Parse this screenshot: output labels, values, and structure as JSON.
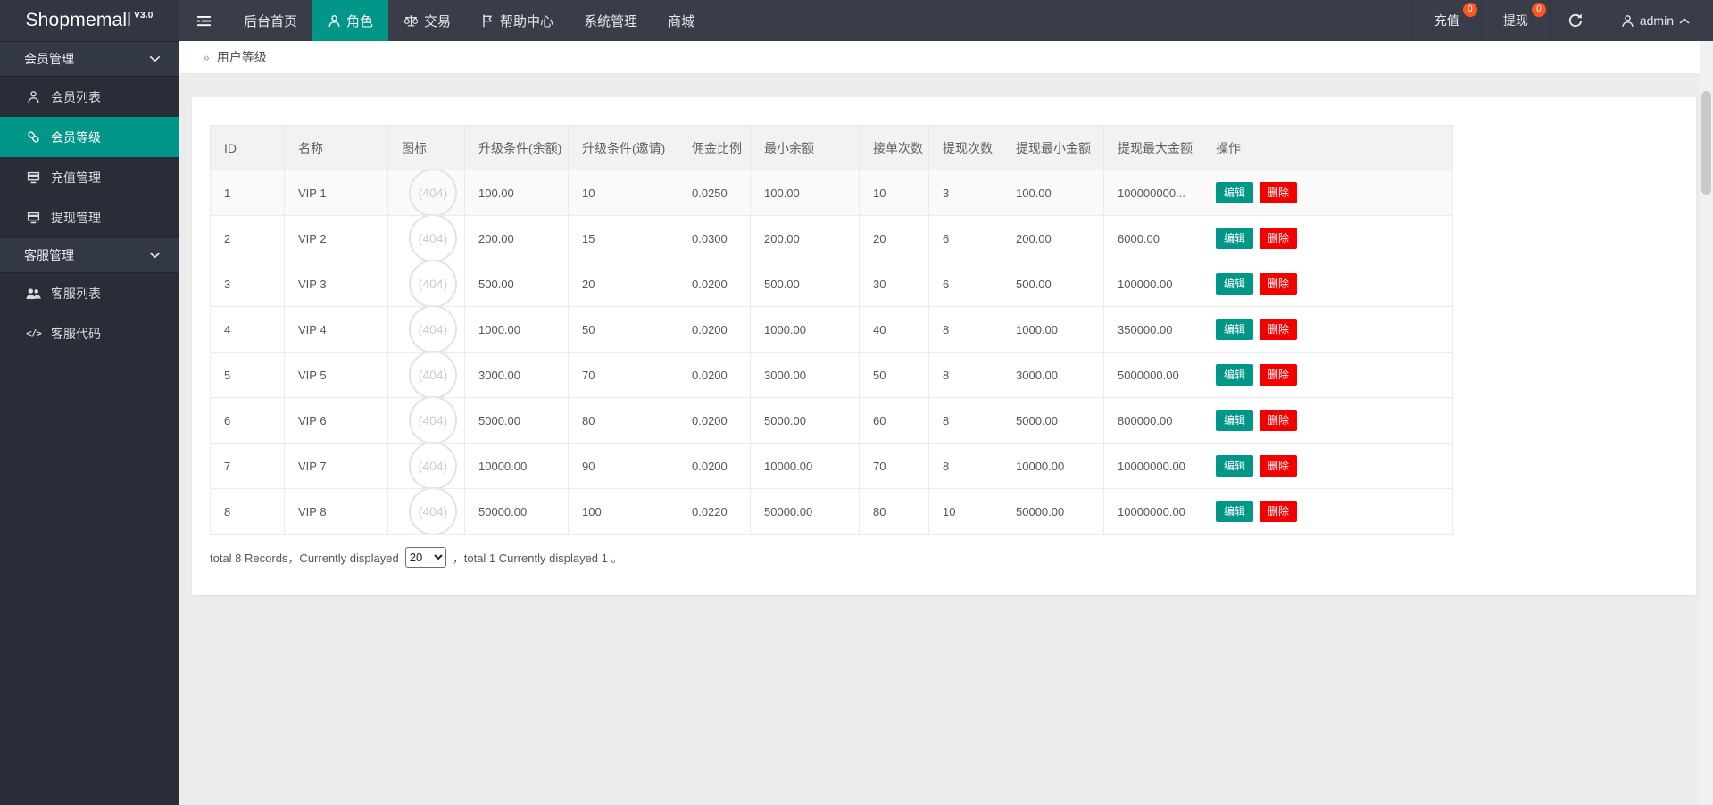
{
  "app": {
    "logo": "Shopmemall",
    "version": "V3.0"
  },
  "navbar": {
    "toggle_icon": "hamburger-icon",
    "tabs": [
      {
        "key": "dashboard",
        "label": "后台首页",
        "icon": null,
        "active": false
      },
      {
        "key": "roles",
        "label": "角色",
        "icon": "person-icon",
        "active": true
      },
      {
        "key": "trade",
        "label": "交易",
        "icon": "scales-icon",
        "active": false
      },
      {
        "key": "help-center",
        "label": "帮助中心",
        "icon": "flag-icon",
        "active": false
      },
      {
        "key": "system",
        "label": "系统管理",
        "icon": null,
        "active": false
      },
      {
        "key": "mall",
        "label": "商城",
        "icon": null,
        "active": false
      }
    ],
    "shortcuts": [
      {
        "key": "recharge",
        "label": "充值",
        "badge": "0"
      },
      {
        "key": "withdraw",
        "label": "提现",
        "badge": "0"
      }
    ],
    "refresh_icon": "refresh-icon",
    "user": {
      "icon": "person-icon",
      "name": "admin",
      "chevron": "chevron-up-icon"
    }
  },
  "sidebar": {
    "groups": [
      {
        "key": "member-management",
        "label": "会员管理",
        "chevron": "chevron-down-icon",
        "items": [
          {
            "key": "member-list",
            "label": "会员列表",
            "icon": "person-icon",
            "active": false
          },
          {
            "key": "member-level",
            "label": "会员等级",
            "icon": "link-icon",
            "active": true
          },
          {
            "key": "recharge-management",
            "label": "充值管理",
            "icon": "card-icon",
            "active": false
          },
          {
            "key": "withdraw-management",
            "label": "提现管理",
            "icon": "card-icon",
            "active": false
          }
        ]
      },
      {
        "key": "service-management",
        "label": "客服管理",
        "chevron": "chevron-down-icon",
        "items": [
          {
            "key": "service-list",
            "label": "客服列表",
            "icon": "people-icon",
            "active": false
          },
          {
            "key": "service-code",
            "label": "客服代码",
            "icon": "code-icon",
            "active": false
          }
        ]
      }
    ]
  },
  "breadcrumb": {
    "icon": "»",
    "label": "用户等级"
  },
  "table": {
    "headers": [
      "ID",
      "名称",
      "图标",
      "升级条件(余额)",
      "升级条件(邀请)",
      "佣金比例",
      "最小余额",
      "接单次数",
      "提现次数",
      "提现最小金额",
      "提现最大金额",
      "操作"
    ],
    "icon_placeholder": "(404)",
    "actions": {
      "edit": "编辑",
      "delete": "删除"
    },
    "rows": [
      [
        "1",
        "VIP 1",
        "100.00",
        "10",
        "0.0250",
        "100.00",
        "10",
        "3",
        "100.00",
        "100000000..."
      ],
      [
        "2",
        "VIP 2",
        "200.00",
        "15",
        "0.0300",
        "200.00",
        "20",
        "6",
        "200.00",
        "6000.00"
      ],
      [
        "3",
        "VIP 3",
        "500.00",
        "20",
        "0.0200",
        "500.00",
        "30",
        "6",
        "500.00",
        "100000.00"
      ],
      [
        "4",
        "VIP 4",
        "1000.00",
        "50",
        "0.0200",
        "1000.00",
        "40",
        "8",
        "1000.00",
        "350000.00"
      ],
      [
        "5",
        "VIP 5",
        "3000.00",
        "70",
        "0.0200",
        "3000.00",
        "50",
        "8",
        "3000.00",
        "5000000.00"
      ],
      [
        "6",
        "VIP 6",
        "5000.00",
        "80",
        "0.0200",
        "5000.00",
        "60",
        "8",
        "5000.00",
        "800000.00"
      ],
      [
        "7",
        "VIP 7",
        "10000.00",
        "90",
        "0.0200",
        "10000.00",
        "70",
        "8",
        "10000.00",
        "10000000.00"
      ],
      [
        "8",
        "VIP 8",
        "50000.00",
        "100",
        "0.0220",
        "50000.00",
        "80",
        "10",
        "50000.00",
        "10000000.00"
      ]
    ]
  },
  "pagination": {
    "text_before": "total 8 Records，Currently displayed",
    "page_size": "20",
    "options": [
      "20"
    ],
    "text_mid": "，",
    "text_after": "total 1 Currently displayed 1 。"
  },
  "colors": {
    "accent": "#009688",
    "danger": "#f20000",
    "badge": "#ff5722",
    "navbar_bg": "#393d49",
    "sidebar_bg": "#282d37"
  }
}
